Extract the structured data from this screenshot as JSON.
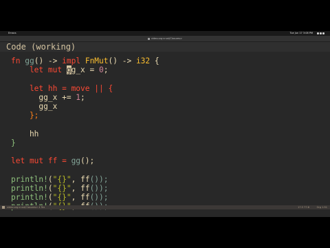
{
  "topbar": {
    "activities": "Emacs",
    "clock": "Tue Jun 17 3:08 PM",
    "tray_icons": [
      "network-icon",
      "volume-icon",
      "power-icon"
    ]
  },
  "window": {
    "title": "video.org<rust/Closures>"
  },
  "heading": "Code (working)",
  "code": [
    [
      "fn ",
      "gg",
      "() -> ",
      "impl",
      " ",
      "FnMut",
      "() -> ",
      "i32",
      " {"
    ],
    [
      "    let mut ",
      "g",
      "g_x = ",
      "0",
      ";"
    ],
    [
      "    let hh = ",
      "move",
      " || {"
    ],
    [
      "      gg_x += ",
      "1",
      ";"
    ],
    [
      "      gg_x"
    ],
    [
      "    };"
    ],
    [
      "    hh"
    ],
    [
      "}"
    ],
    [
      "let mut ff = ",
      "gg",
      "();"
    ],
    [
      "println!",
      "(",
      "\"{}\"",
      ", ",
      "ff",
      "());"
    ],
    [
      "println!",
      "(",
      "\"{}\"",
      ", ",
      "ff",
      "());"
    ],
    [
      "println!",
      "(",
      "\"{}\"",
      ", ",
      "ff",
      "());"
    ],
    [
      "println!",
      "(",
      "\"{}\"",
      ", ",
      "ff",
      "());"
    ]
  ],
  "status": {
    "file": "video.org<rust/Closures>   4 Tex",
    "position": "17:3 77:8",
    "language": "Org 1:51"
  }
}
